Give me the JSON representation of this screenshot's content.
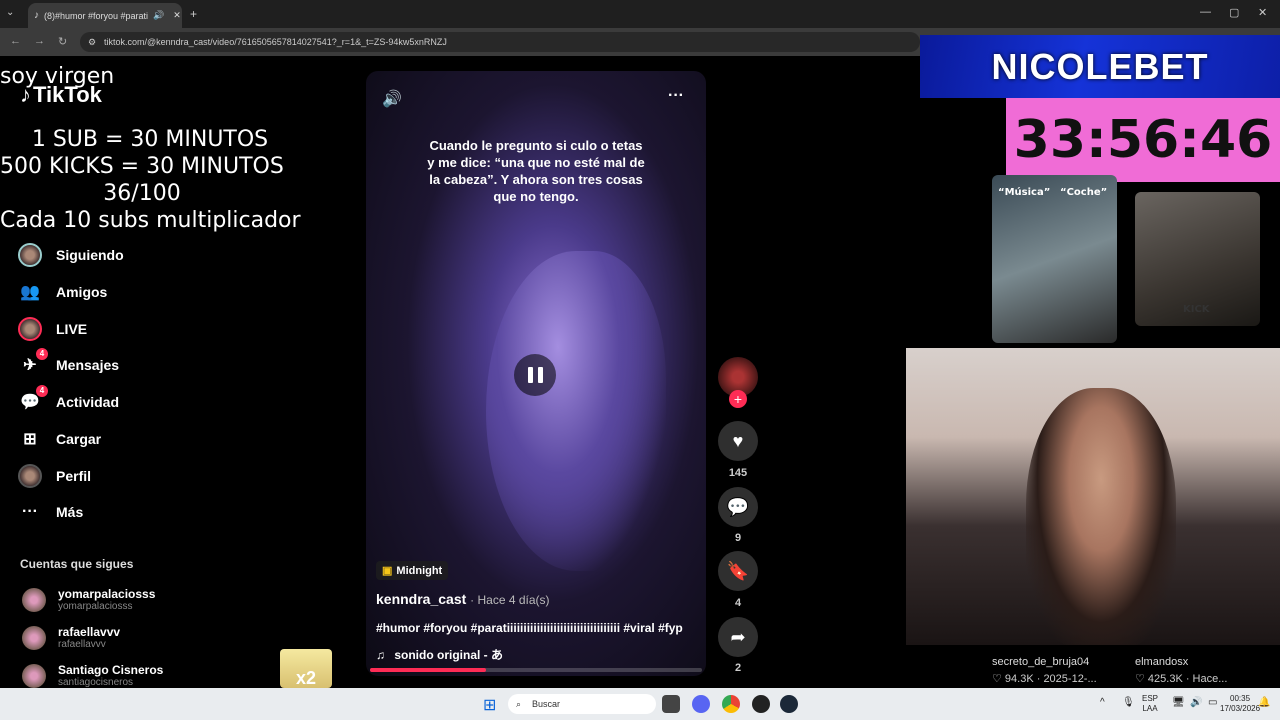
{
  "browser": {
    "tab_title": "(8)#humor #foryou #parati",
    "url": "tiktok.com/@kenndra_cast/video/7616505657814027541?_r=1&_t=ZS-94kw5xnRNZJ",
    "new_tab": "+",
    "window_controls": [
      "—",
      "▢",
      "✕"
    ]
  },
  "overlay": {
    "line1": "soy virgen",
    "line2": "1 SUB      = 30 MINUTOS",
    "line3": "500 KICKS = 30 MINUTOS",
    "line4": "36/100",
    "line5": "Cada 10 subs multiplicador"
  },
  "tiktok": {
    "logo": "TikTok",
    "nav": [
      {
        "label": "Siguiendo",
        "icon": "following-avatar-icon"
      },
      {
        "label": "Amigos",
        "icon": "friends-icon"
      },
      {
        "label": "LIVE",
        "icon": "live-avatar-icon"
      },
      {
        "label": "Mensajes",
        "icon": "messages-icon",
        "badge": "4"
      },
      {
        "label": "Actividad",
        "icon": "activity-icon",
        "badge": "4"
      },
      {
        "label": "Cargar",
        "icon": "upload-icon"
      },
      {
        "label": "Perfil",
        "icon": "profile-icon"
      },
      {
        "label": "Más",
        "icon": "more-icon"
      }
    ],
    "following_title": "Cuentas que sigues",
    "accounts": [
      {
        "name": "yomarpalaciosss",
        "handle": "yomarpalaciosss"
      },
      {
        "name": "rafaellavvv",
        "handle": "rafaellavvv"
      },
      {
        "name": "Santiago Cisneros",
        "handle": "santiagocisneros"
      }
    ]
  },
  "video": {
    "caption": "Cuando le pregunto si culo o tetas y me dice: “una que no esté mal de la cabeza”. Y ahora son tres cosas que no tengo.",
    "music_tag": "Midnight",
    "author": "kenndra_cast",
    "time": "· Hace 4 día(s)",
    "hashtags": "#humor #foryou #paratiiiiiiiiiiiiiiiiiiiiiiiiiiiiiiiiii #viral #fyp",
    "sound": "sonido original - あ",
    "progress": 0.35,
    "likes": "145",
    "comments": "9",
    "saves": "4",
    "shares": "2"
  },
  "stream": {
    "brand": "NICOLEBET",
    "timer": "33:56:46",
    "thumb1_labels": [
      "“Música”",
      "“Coche”"
    ],
    "thumb2_label": "KICK",
    "cards": [
      {
        "name": "secreto_de_bruja04",
        "stats": "♡ 94.3K · 2025-12-..."
      },
      {
        "name": "elmandosx",
        "stats": "♡ 425.3K · Hace..."
      }
    ]
  },
  "taskbar": {
    "search": "Buscar",
    "lang1": "ESP",
    "lang2": "LAA",
    "time": "00:35",
    "date": "17/03/2026"
  },
  "colors": {
    "accent": "#fe2c55",
    "timer_bg": "#f06cd6",
    "brand_bg": "#1533d8"
  }
}
